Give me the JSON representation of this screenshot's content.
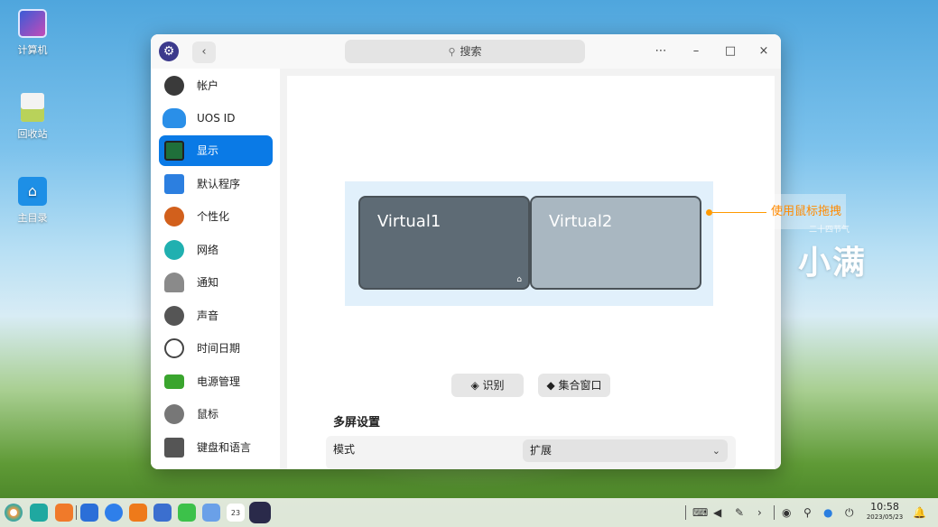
{
  "desktop": {
    "icons": [
      {
        "label": "计算机",
        "icon": "computer-icon"
      },
      {
        "label": "回收站",
        "icon": "trash-icon"
      },
      {
        "label": "主目录",
        "icon": "home-folder-icon"
      }
    ],
    "brand_sub": "二十四节气",
    "brand": "小满"
  },
  "titlebar": {
    "search_placeholder": "搜索",
    "back_icon": "‹",
    "menu_icon": "⋯",
    "minimize_icon": "–",
    "maximize_icon": "□",
    "close_icon": "×"
  },
  "sidebar": {
    "items": [
      {
        "label": "帐户",
        "icon": "account-icon",
        "color": "#3a3a3a"
      },
      {
        "label": "UOS ID",
        "icon": "cloud-icon",
        "color": "#2a8fe8"
      },
      {
        "label": "显示",
        "icon": "display-icon",
        "color": "#1f6f3a"
      },
      {
        "label": "默认程序",
        "icon": "default-apps-icon",
        "color": "#2c7fe0"
      },
      {
        "label": "个性化",
        "icon": "personalization-icon",
        "color": "#d2601c"
      },
      {
        "label": "网络",
        "icon": "network-icon",
        "color": "#20b0b0"
      },
      {
        "label": "通知",
        "icon": "notification-icon",
        "color": "#8a8a8a"
      },
      {
        "label": "声音",
        "icon": "sound-icon",
        "color": "#555555"
      },
      {
        "label": "时间日期",
        "icon": "clock-icon",
        "color": "#444444"
      },
      {
        "label": "电源管理",
        "icon": "power-icon",
        "color": "#3aa52e"
      },
      {
        "label": "鼠标",
        "icon": "mouse-icon",
        "color": "#777777"
      },
      {
        "label": "键盘和语言",
        "icon": "keyboard-icon",
        "color": "#555555"
      }
    ],
    "active_index": 2
  },
  "display": {
    "monitors": [
      {
        "name": "Virtual1",
        "primary": true
      },
      {
        "name": "Virtual2",
        "primary": false
      }
    ],
    "tooltip": "使用鼠标拖拽",
    "identify_label": "识别",
    "gather_label": "集合窗口",
    "section_title": "多屏设置",
    "mode_label": "模式",
    "mode_value": "扩展"
  },
  "taskbar": {
    "apps": [
      "launcher-icon",
      "app-store-icon",
      "file-manager-icon",
      "browser-icon",
      "music-icon",
      "photos-icon",
      "mail-icon",
      "notes-icon",
      "calendar-icon",
      "settings-icon"
    ],
    "calendar_day": "23",
    "time": "10:58",
    "date": "2023/05/23"
  },
  "colors": {
    "accent": "#0a7ae6",
    "tooltip": "#ff8a00"
  }
}
